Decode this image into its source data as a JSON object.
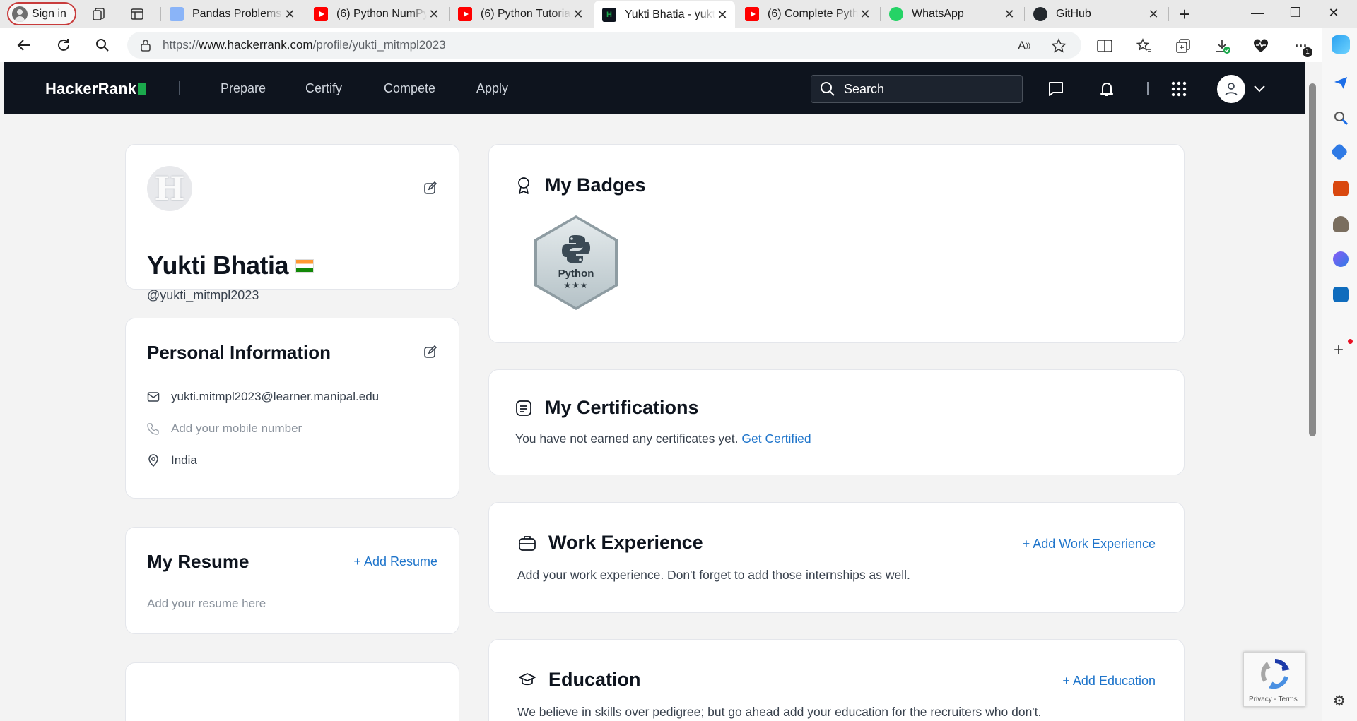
{
  "browser": {
    "signin_label": "Sign in",
    "tabs": [
      {
        "title": "Pandas Problems:",
        "favicon": "docs-icon"
      },
      {
        "title": "(6) Python NumPy",
        "favicon": "youtube-icon"
      },
      {
        "title": "(6) Python Tutorial",
        "favicon": "youtube-icon"
      },
      {
        "title": "Yukti Bhatia - yukti",
        "favicon": "hackerrank-icon",
        "active": true
      },
      {
        "title": "(6) Complete Pytho",
        "favicon": "youtube-icon"
      },
      {
        "title": "WhatsApp",
        "favicon": "whatsapp-icon"
      },
      {
        "title": "GitHub",
        "favicon": "github-icon"
      }
    ],
    "url_prefix": "https://",
    "url_host": "www.hackerrank.com",
    "url_path": "/profile/yukti_mitmpl2023",
    "download_badge": "1"
  },
  "header": {
    "logo": "HackerRank",
    "nav": [
      "Prepare",
      "Certify",
      "Compete",
      "Apply"
    ],
    "search_placeholder": "Search"
  },
  "profile": {
    "avatar_letter": "H",
    "name": "Yukti Bhatia",
    "handle": "@yukti_mitmpl2023"
  },
  "personal_info": {
    "title": "Personal Information",
    "email": "yukti.mitmpl2023@learner.manipal.edu",
    "mobile_placeholder": "Add your mobile number",
    "location": "India"
  },
  "resume": {
    "title": "My Resume",
    "add_label": "+ Add Resume",
    "placeholder": "Add your resume here"
  },
  "badges": {
    "title": "My Badges",
    "items": [
      {
        "name": "Python",
        "stars": "★★★"
      }
    ]
  },
  "certifications": {
    "title": "My Certifications",
    "text": "You have not earned any certificates yet.",
    "link": "Get Certified"
  },
  "work": {
    "title": "Work Experience",
    "add_label": "+ Add Work Experience",
    "text": "Add your work experience. Don't forget to add those internships as well."
  },
  "education": {
    "title": "Education",
    "add_label": "+ Add Education",
    "text": "We believe in skills over pedigree; but go ahead add your education for the recruiters who don't."
  },
  "recaptcha": {
    "label": "Privacy - Terms"
  },
  "colors": {
    "brand_green": "#1ba94c",
    "header_bg": "#0e141e",
    "link": "#1f75cb"
  }
}
